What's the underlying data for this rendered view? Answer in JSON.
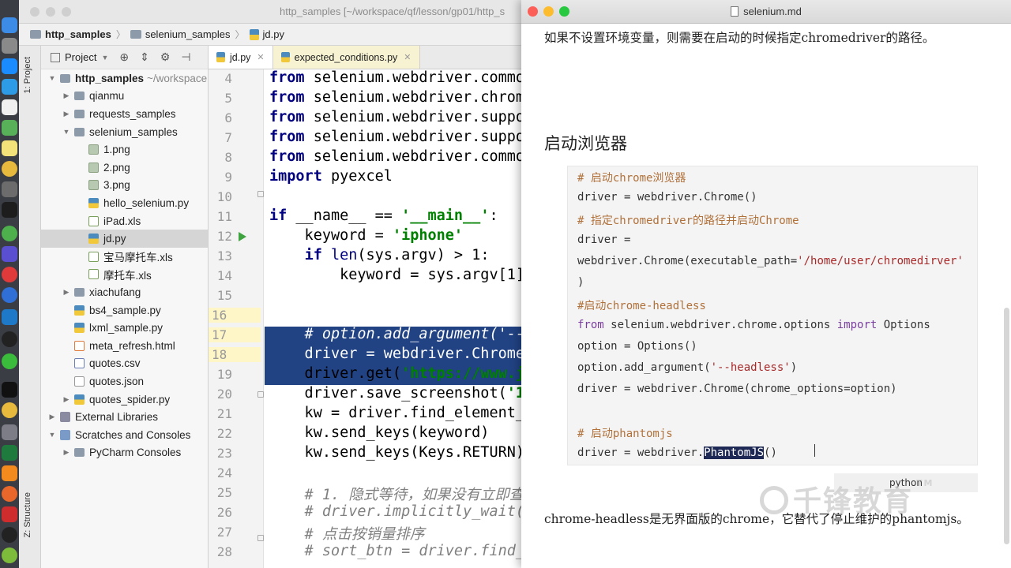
{
  "ide": {
    "window_title": "http_samples [~/workspace/qf/lesson/gp01/http_s",
    "breadcrumbs": [
      "http_samples",
      "selenium_samples",
      "jd.py"
    ],
    "tool_tabs": {
      "project": "1: Project",
      "structure": "Z: Structure"
    },
    "project_panel": {
      "title": "Project",
      "tree": [
        {
          "label": "http_samples",
          "extra": "~/workspace",
          "type": "folder",
          "level": 0,
          "expanded": true
        },
        {
          "label": "qianmu",
          "type": "folder",
          "level": 1,
          "expanded": false
        },
        {
          "label": "requests_samples",
          "type": "folder",
          "level": 1,
          "expanded": false
        },
        {
          "label": "selenium_samples",
          "type": "folder",
          "level": 1,
          "expanded": true
        },
        {
          "label": "1.png",
          "type": "png",
          "level": 2
        },
        {
          "label": "2.png",
          "type": "png",
          "level": 2
        },
        {
          "label": "3.png",
          "type": "png",
          "level": 2
        },
        {
          "label": "hello_selenium.py",
          "type": "py",
          "level": 2
        },
        {
          "label": "iPad.xls",
          "type": "xls",
          "level": 2
        },
        {
          "label": "jd.py",
          "type": "py",
          "level": 2,
          "selected": true
        },
        {
          "label": "宝马摩托车.xls",
          "type": "xls",
          "level": 2
        },
        {
          "label": "摩托车.xls",
          "type": "xls",
          "level": 2
        },
        {
          "label": "xiachufang",
          "type": "folder",
          "level": 1,
          "expanded": false
        },
        {
          "label": "bs4_sample.py",
          "type": "py",
          "level": 1
        },
        {
          "label": "lxml_sample.py",
          "type": "py",
          "level": 1
        },
        {
          "label": "meta_refresh.html",
          "type": "html",
          "level": 1
        },
        {
          "label": "quotes.csv",
          "type": "csv",
          "level": 1
        },
        {
          "label": "quotes.json",
          "type": "json",
          "level": 1
        },
        {
          "label": "quotes_spider.py",
          "type": "py",
          "level": 1,
          "expanded": false
        },
        {
          "label": "External Libraries",
          "type": "lib",
          "level": 0,
          "expanded": false
        },
        {
          "label": "Scratches and Consoles",
          "type": "scr",
          "level": 0,
          "expanded": true
        },
        {
          "label": "PyCharm Consoles",
          "type": "folder",
          "level": 1,
          "expanded": false
        }
      ]
    },
    "editor_tabs": [
      {
        "label": "jd.py",
        "active": true
      },
      {
        "label": "expected_conditions.py",
        "active": false
      }
    ],
    "line_numbers": [
      "4",
      "5",
      "6",
      "7",
      "8",
      "9",
      "10",
      "11",
      "12",
      "13",
      "14",
      "15",
      "16",
      "17",
      "18",
      "19",
      "20",
      "21",
      "22",
      "23",
      "24",
      "25",
      "26",
      "27",
      "28"
    ]
  },
  "markdown": {
    "window_title": "selenium.md",
    "intro": "如果不设置环境变量，则需要在启动的时候指定chromedriver的路径。",
    "heading": "启动浏览器",
    "code_lang": "python",
    "outro": "chrome-headless是无界面版的chrome，它替代了停止维护的phantomjs。",
    "watermark": "千锋教育",
    "watermark_tm": "TM"
  }
}
